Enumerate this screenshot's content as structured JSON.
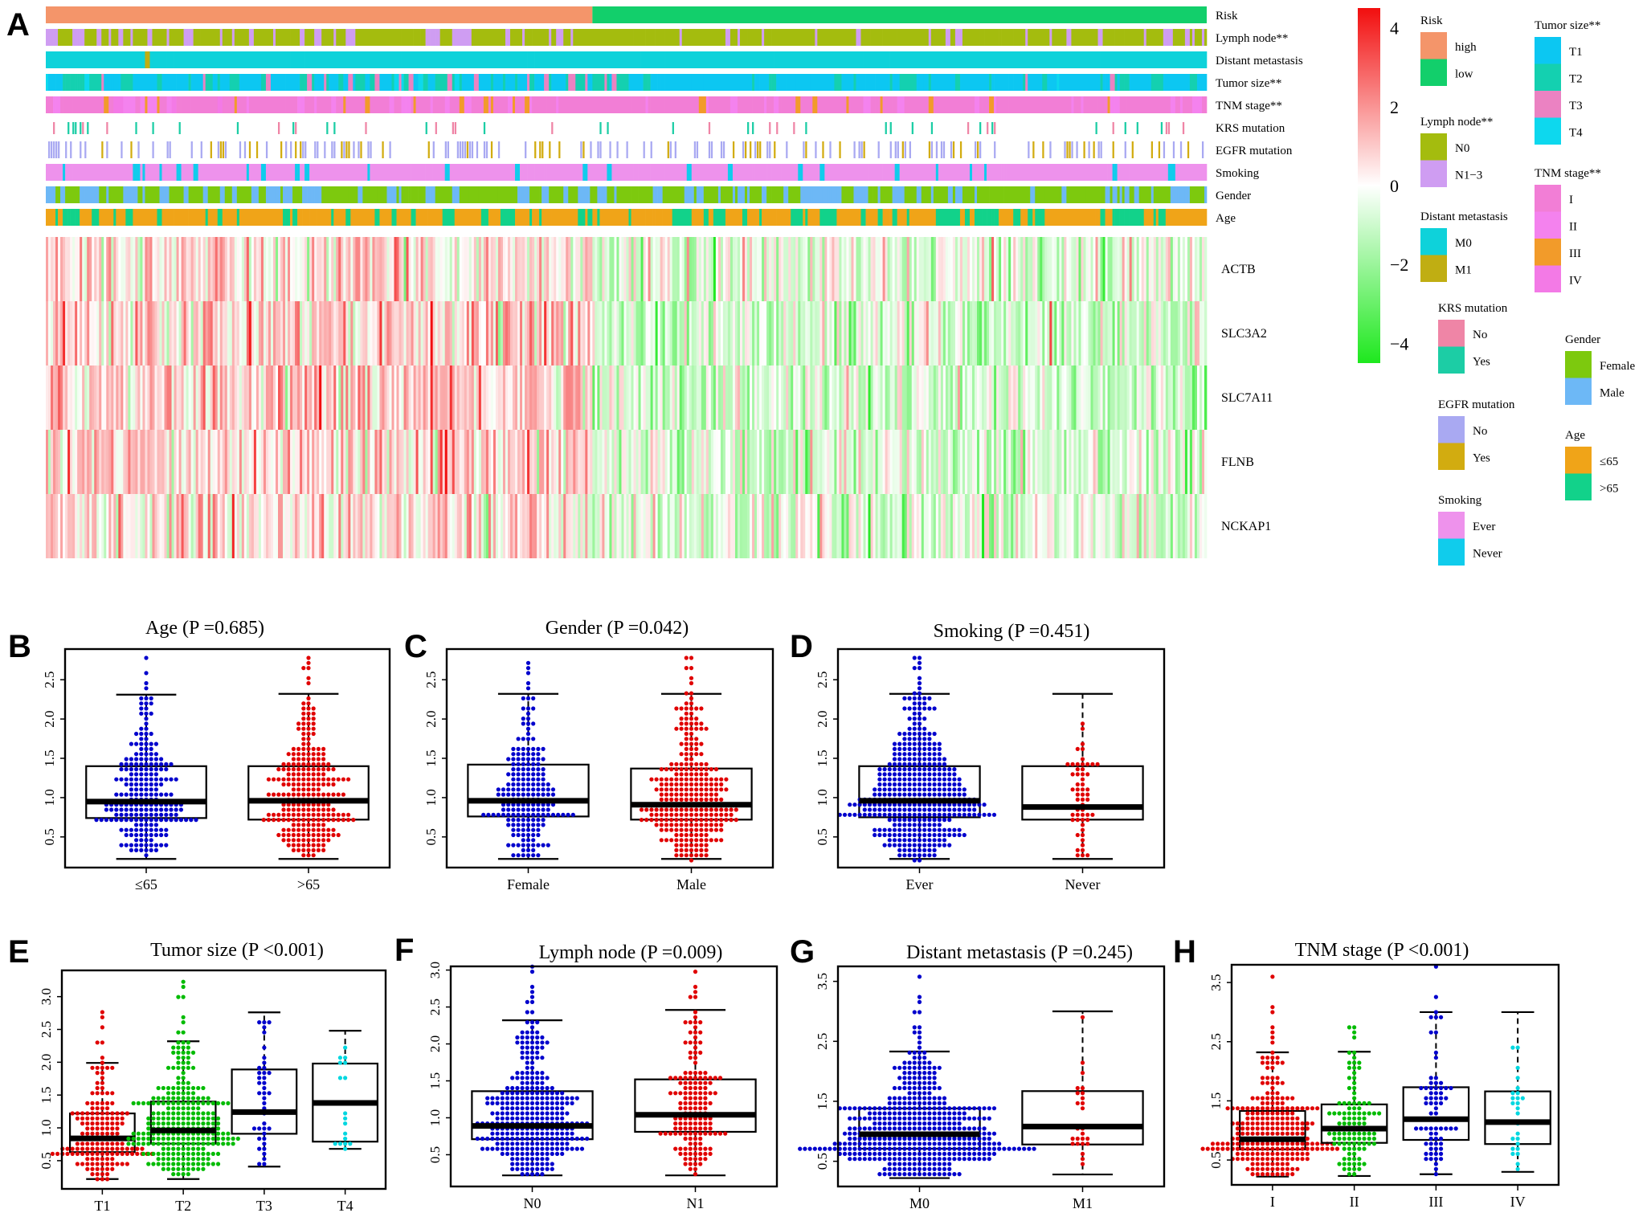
{
  "figure": {
    "panel_letters": [
      "A",
      "B",
      "C",
      "D",
      "E",
      "F",
      "G",
      "H"
    ]
  },
  "chart_data": [
    {
      "panel": "A",
      "type": "heatmap",
      "title": "",
      "risk_split_fraction_high": 0.47,
      "annotation_rows": [
        {
          "label": "Risk",
          "legend_title": "Risk",
          "levels": [
            {
              "name": "high",
              "color": "#F4956A"
            },
            {
              "name": "low",
              "color": "#12CF6B"
            }
          ]
        },
        {
          "label": "Lymph node**",
          "legend_title": "Lymph node**",
          "levels": [
            {
              "name": "N0",
              "color": "#A4BC0E"
            },
            {
              "name": "N1−3",
              "color": "#CF9DF2"
            }
          ]
        },
        {
          "label": "Distant metastasis",
          "legend_title": "Distant metastasis",
          "levels": [
            {
              "name": "M0",
              "color": "#0ED2DA"
            },
            {
              "name": "M1",
              "color": "#C0AE12"
            }
          ]
        },
        {
          "label": "Tumor size**",
          "legend_title": "Tumor size**",
          "levels": [
            {
              "name": "T1",
              "color": "#0CC7F2"
            },
            {
              "name": "T2",
              "color": "#14D0B0"
            },
            {
              "name": "T3",
              "color": "#EB82C2"
            },
            {
              "name": "T4",
              "color": "#0DD8EE"
            }
          ]
        },
        {
          "label": "TNM stage**",
          "legend_title": "TNM stage**",
          "levels": [
            {
              "name": "I",
              "color": "#F27ED6"
            },
            {
              "name": "II",
              "color": "#F482EE"
            },
            {
              "name": "III",
              "color": "#F29B2A"
            },
            {
              "name": "IV",
              "color": "#F37AE6"
            }
          ]
        },
        {
          "label": "KRS mutation",
          "legend_title": "KRS mutation",
          "levels": [
            {
              "name": "No",
              "color": "#EF85A6"
            },
            {
              "name": "Yes",
              "color": "#1CCDA5"
            }
          ]
        },
        {
          "label": "EGFR mutation",
          "legend_title": "EGFR mutation",
          "levels": [
            {
              "name": "No",
              "color": "#A9A9F2"
            },
            {
              "name": "Yes",
              "color": "#D2AC10"
            }
          ]
        },
        {
          "label": "Smoking",
          "legend_title": "Smoking",
          "levels": [
            {
              "name": "Ever",
              "color": "#EE92EC"
            },
            {
              "name": "Never",
              "color": "#10CCEC"
            }
          ]
        },
        {
          "label": "Gender",
          "legend_title": "Gender",
          "levels": [
            {
              "name": "Female",
              "color": "#7DC90E"
            },
            {
              "name": "Male",
              "color": "#6DB8F6"
            }
          ]
        },
        {
          "label": "Age",
          "legend_title": "Age",
          "levels": [
            {
              "name": "≤65",
              "color": "#F0A418"
            },
            {
              "name": ">65",
              "color": "#12D28A"
            }
          ]
        }
      ],
      "genes": [
        "ACTB",
        "SLC3A2",
        "SLC7A11",
        "FLNB",
        "NCKAP1"
      ],
      "colorbar": {
        "min": -4.5,
        "max": 4.5,
        "ticks": [
          4,
          2,
          0,
          -2,
          -4
        ],
        "tick_labels": [
          "4",
          "2",
          "0",
          "−2",
          "−4"
        ],
        "low_color": "#1EE81E",
        "mid_color": "#FFFFFF",
        "high_color": "#F20E0E"
      }
    },
    {
      "panel": "B",
      "type": "box",
      "title": "Age (P =0.685)",
      "categories": [
        "≤65",
        ">65"
      ],
      "colors": [
        "#0000CC",
        "#E00000"
      ],
      "ylim": [
        0.11,
        2.89
      ],
      "yticks": [
        0.5,
        1.0,
        1.5,
        2.0,
        2.5
      ],
      "stats": [
        {
          "whisker_low": 0.22,
          "q1": 0.74,
          "median": 0.95,
          "q3": 1.4,
          "whisker_high": 2.31,
          "outliers": [
            2.42,
            2.45,
            2.6,
            2.79
          ],
          "n_approx": 230
        },
        {
          "whisker_low": 0.22,
          "q1": 0.72,
          "median": 0.96,
          "q3": 1.4,
          "whisker_high": 2.32,
          "outliers": [
            2.45,
            2.54,
            2.62,
            2.66,
            2.7,
            2.75
          ],
          "n_approx": 260
        }
      ]
    },
    {
      "panel": "C",
      "type": "box",
      "title": "Gender (P =0.042)",
      "categories": [
        "Female",
        "Male"
      ],
      "colors": [
        "#0000CC",
        "#E00000"
      ],
      "ylim": [
        0.11,
        2.89
      ],
      "yticks": [
        0.5,
        1.0,
        1.5,
        2.0,
        2.5
      ],
      "stats": [
        {
          "whisker_low": 0.22,
          "q1": 0.76,
          "median": 0.96,
          "q3": 1.42,
          "whisker_high": 2.32,
          "outliers": [
            2.42,
            2.46,
            2.6,
            2.66,
            2.69
          ],
          "n_approx": 200
        },
        {
          "whisker_low": 0.22,
          "q1": 0.72,
          "median": 0.91,
          "q3": 1.37,
          "whisker_high": 2.32,
          "outliers": [
            2.46,
            2.54,
            2.62,
            2.66,
            2.75,
            2.79
          ],
          "n_approx": 290
        }
      ]
    },
    {
      "panel": "D",
      "type": "box",
      "title": "Smoking (P =0.451)",
      "categories": [
        "Ever",
        "Never"
      ],
      "colors": [
        "#0000CC",
        "#E00000"
      ],
      "ylim": [
        0.11,
        2.89
      ],
      "yticks": [
        0.5,
        1.0,
        1.5,
        2.0,
        2.5
      ],
      "stats": [
        {
          "whisker_low": 0.22,
          "q1": 0.75,
          "median": 0.96,
          "q3": 1.4,
          "whisker_high": 2.32,
          "outliers": [
            2.42,
            2.46,
            2.54,
            2.62,
            2.66,
            2.7,
            2.75,
            2.79
          ],
          "n_approx": 420
        },
        {
          "whisker_low": 0.22,
          "q1": 0.72,
          "median": 0.88,
          "q3": 1.4,
          "whisker_high": 2.32,
          "outliers": [],
          "n_approx": 55
        }
      ]
    },
    {
      "panel": "E",
      "type": "box",
      "title": "Tumor size (P <0.001)",
      "categories": [
        "T1",
        "T2",
        "T3",
        "T4"
      ],
      "colors": [
        "#E00000",
        "#00BB00",
        "#0000CC",
        "#00D7E0"
      ],
      "ylim": [
        0.07,
        3.4
      ],
      "yticks": [
        0.5,
        1.0,
        1.5,
        2.0,
        2.5,
        3.0
      ],
      "stats": [
        {
          "whisker_low": 0.22,
          "q1": 0.63,
          "median": 0.84,
          "q3": 1.22,
          "whisker_high": 1.99,
          "outliers": [
            2.1,
            2.29,
            2.3,
            2.54,
            2.68,
            2.79
          ],
          "n_approx": 170
        },
        {
          "whisker_low": 0.22,
          "q1": 0.76,
          "median": 0.96,
          "q3": 1.4,
          "whisker_high": 2.32,
          "outliers": [
            2.42,
            2.46,
            2.6,
            2.66,
            2.98,
            3.02,
            3.12,
            3.24
          ],
          "n_approx": 280
        },
        {
          "whisker_low": 0.41,
          "q1": 0.91,
          "median": 1.24,
          "q3": 1.89,
          "whisker_high": 2.76,
          "outliers": [],
          "n_approx": 40
        },
        {
          "whisker_low": 0.68,
          "q1": 0.79,
          "median": 1.38,
          "q3": 1.98,
          "whisker_high": 2.48,
          "outliers": [],
          "n_approx": 18
        }
      ]
    },
    {
      "panel": "F",
      "type": "box",
      "title": "Lymph node (P =0.009)",
      "categories": [
        "N0",
        "N1"
      ],
      "colors": [
        "#0000CC",
        "#E00000"
      ],
      "ylim": [
        0.07,
        3.05
      ],
      "yticks": [
        0.5,
        1.0,
        1.5,
        2.0,
        2.5,
        3.0
      ],
      "stats": [
        {
          "whisker_low": 0.22,
          "q1": 0.71,
          "median": 0.89,
          "q3": 1.36,
          "whisker_high": 2.32,
          "outliers": [
            2.42,
            2.46,
            2.54,
            2.6,
            2.66,
            2.7,
            2.76,
            2.98,
            3.02
          ],
          "n_approx": 330
        },
        {
          "whisker_low": 0.22,
          "q1": 0.81,
          "median": 1.04,
          "q3": 1.52,
          "whisker_high": 2.46,
          "outliers": [
            2.62,
            2.66,
            2.7,
            2.79,
            2.98
          ],
          "n_approx": 160
        }
      ]
    },
    {
      "panel": "G",
      "type": "box",
      "title": "Distant metastasis (P =0.245)",
      "categories": [
        "M0",
        "M1"
      ],
      "colors": [
        "#0000CC",
        "#E00000"
      ],
      "ylim": [
        0.08,
        3.75
      ],
      "yticks": [
        0.5,
        1.5,
        2.5,
        3.5
      ],
      "stats": [
        {
          "whisker_low": 0.22,
          "q1": 0.71,
          "median": 0.95,
          "q3": 1.38,
          "whisker_high": 2.33,
          "outliers": [
            2.42,
            2.46,
            2.54,
            2.62,
            2.66,
            2.7,
            2.76,
            3.0,
            3.02,
            3.12,
            3.24,
            3.58
          ],
          "n_approx": 470
        },
        {
          "whisker_low": 0.28,
          "q1": 0.78,
          "median": 1.08,
          "q3": 1.67,
          "whisker_high": 3.0,
          "outliers": [],
          "n_approx": 25
        }
      ]
    },
    {
      "panel": "H",
      "type": "box",
      "title": "TNM stage (P <0.001)",
      "categories": [
        "I",
        "II",
        "III",
        "IV"
      ],
      "colors": [
        "#E00000",
        "#00BB00",
        "#0000CC",
        "#00D7E0"
      ],
      "ylim": [
        0.08,
        3.8
      ],
      "yticks": [
        0.5,
        1.5,
        2.5,
        3.5
      ],
      "stats": [
        {
          "whisker_low": 0.22,
          "q1": 0.68,
          "median": 0.85,
          "q3": 1.33,
          "whisker_high": 2.32,
          "outliers": [
            2.46,
            2.54,
            2.66,
            2.7,
            3.02,
            3.12,
            3.58
          ],
          "n_approx": 260
        },
        {
          "whisker_low": 0.23,
          "q1": 0.79,
          "median": 1.03,
          "q3": 1.44,
          "whisker_high": 2.33,
          "outliers": [
            2.54,
            2.66,
            2.74,
            2.78
          ],
          "n_approx": 110
        },
        {
          "whisker_low": 0.26,
          "q1": 0.84,
          "median": 1.19,
          "q3": 1.73,
          "whisker_high": 3.0,
          "outliers": [
            3.26,
            3.8
          ],
          "n_approx": 70
        },
        {
          "whisker_low": 0.3,
          "q1": 0.77,
          "median": 1.14,
          "q3": 1.66,
          "whisker_high": 3.0,
          "outliers": [],
          "n_approx": 25
        }
      ]
    }
  ]
}
